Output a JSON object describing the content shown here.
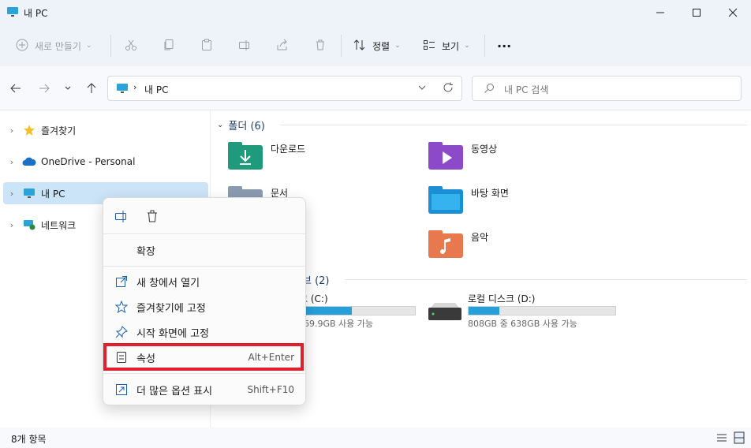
{
  "window": {
    "title": "내 PC"
  },
  "toolbar": {
    "new_label": "새로 만들기",
    "sort_label": "정렬",
    "view_label": "보기",
    "more": "···"
  },
  "address": {
    "path": "내 PC"
  },
  "search": {
    "placeholder": "내 PC 검색"
  },
  "sidebar": {
    "items": [
      {
        "label": "즐겨찾기"
      },
      {
        "label": "OneDrive - Personal"
      },
      {
        "label": "내 PC"
      },
      {
        "label": "네트워크"
      }
    ]
  },
  "content": {
    "folders_header": "폴더 (6)",
    "folders": [
      {
        "label": "다운로드"
      },
      {
        "label": "동영상"
      },
      {
        "label": "문서"
      },
      {
        "label": "바탕 화면"
      },
      {
        "label": "음악"
      }
    ],
    "drives_header": "브 (2)",
    "drives": [
      {
        "label": "크 (C:)",
        "size": "69.9GB 사용 가능",
        "fill": 0.45
      },
      {
        "label": "로컬 디스크 (D:)",
        "size": "808GB 중 638GB 사용 가능",
        "fill": 0.21
      }
    ]
  },
  "context_menu": {
    "expand": "확장",
    "items": [
      {
        "label": "새 창에서 열기",
        "icon": "open-new-window-icon",
        "shortcut": ""
      },
      {
        "label": "즐겨찾기에 고정",
        "icon": "star-icon",
        "shortcut": ""
      },
      {
        "label": "시작 화면에 고정",
        "icon": "pin-icon",
        "shortcut": ""
      },
      {
        "label": "속성",
        "icon": "properties-icon",
        "shortcut": "Alt+Enter"
      },
      {
        "label": "더 많은 옵션 표시",
        "icon": "more-options-icon",
        "shortcut": "Shift+F10"
      }
    ]
  },
  "status": {
    "count": "8개 항목"
  },
  "colors": {
    "accent": "#26a0da",
    "highlight": "#e0202c",
    "selection": "#cce4f7"
  }
}
